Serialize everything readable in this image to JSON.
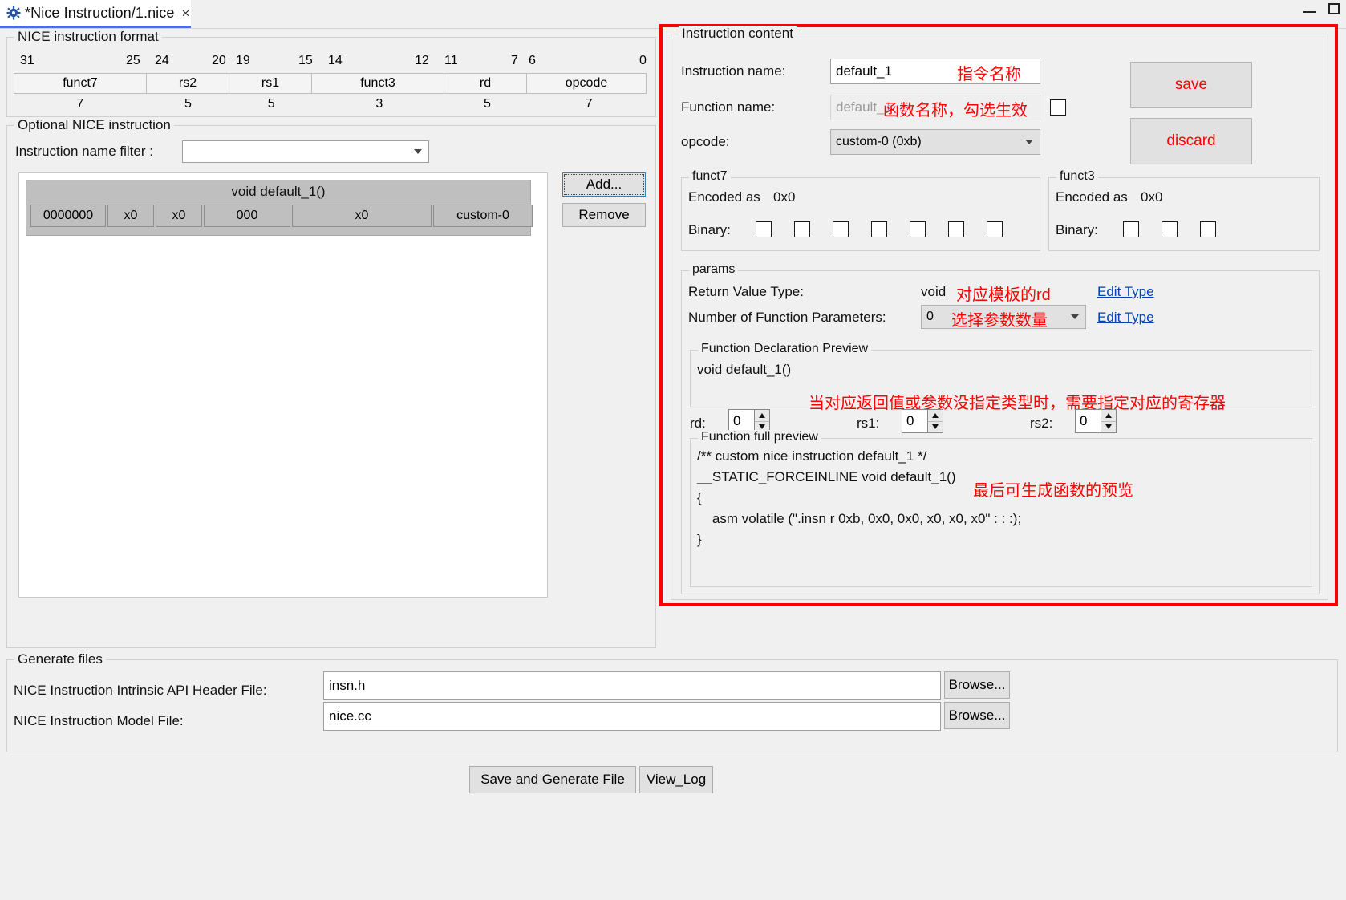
{
  "window": {
    "tab_title": "*Nice Instruction/1.nice",
    "tab_close": "×",
    "minimize": "minimize-icon",
    "maximize": "maximize-icon"
  },
  "format_section": {
    "title": "NICE instruction format",
    "bit_numbers": [
      "31",
      "25",
      "24",
      "20",
      "19",
      "15",
      "14",
      "12",
      "11",
      "7",
      "6",
      "0"
    ],
    "fields": [
      {
        "name": "funct7",
        "width": "7"
      },
      {
        "name": "rs2",
        "width": "5"
      },
      {
        "name": "rs1",
        "width": "5"
      },
      {
        "name": "funct3",
        "width": "3"
      },
      {
        "name": "rd",
        "width": "5"
      },
      {
        "name": "opcode",
        "width": "7"
      }
    ]
  },
  "optional_section": {
    "title": "Optional NICE instruction",
    "filter_label": "Instruction name filter :",
    "filter_value": "",
    "instructions": [
      {
        "signature": "void default_1()",
        "cells": [
          "0000000",
          "x0",
          "x0",
          "000",
          "x0",
          "custom-0"
        ]
      }
    ],
    "add_label": "Add...",
    "remove_label": "Remove"
  },
  "instruction_content": {
    "title": "Instruction content",
    "instruction_name_label": "Instruction name:",
    "instruction_name_value": "default_1",
    "function_name_label": "Function name:",
    "function_name_placeholder": "default_1",
    "function_name_checkbox_checked": false,
    "opcode_label": "opcode:",
    "opcode_value": "custom-0 (0xb)",
    "save_label": "save",
    "discard_label": "discard",
    "annotations": {
      "instruction_name": "指令名称",
      "function_name": "函数名称，勾选生效"
    },
    "funct7": {
      "title": "funct7",
      "encoded_label": "Encoded as",
      "encoded_value": "0x0",
      "binary_label": "Binary:",
      "bits": [
        false,
        false,
        false,
        false,
        false,
        false,
        false
      ]
    },
    "funct3": {
      "title": "funct3",
      "encoded_label": "Encoded as",
      "encoded_value": "0x0",
      "binary_label": "Binary:",
      "bits": [
        false,
        false,
        false
      ]
    },
    "params": {
      "title": "params",
      "return_type_label": "Return Value Type:",
      "return_type_value": "void",
      "return_type_annotation": "对应模板的rd",
      "return_type_edit_link": "Edit Type",
      "param_count_label": "Number of Function Parameters:",
      "param_count_value": "0",
      "param_count_annotation": "选择参数数量",
      "param_count_edit_link": "Edit Type",
      "declaration_preview": {
        "title": "Function Declaration Preview",
        "text": "void default_1()",
        "annotation": "当对应返回值或参数没指定类型时，需要指定对应的寄存器"
      },
      "registers": [
        {
          "label": "rd:",
          "value": "0"
        },
        {
          "label": "rs1:",
          "value": "0"
        },
        {
          "label": "rs2:",
          "value": "0"
        }
      ],
      "full_preview": {
        "title": "Function full preview",
        "annotation": "最后可生成函数的预览",
        "lines": [
          "/** custom nice instruction default_1 */",
          "__STATIC_FORCEINLINE void default_1()",
          "{",
          "    asm volatile (\".insn r 0xb, 0x0, 0x0, x0, x0, x0\" : : :);",
          "}"
        ]
      }
    }
  },
  "generate_files": {
    "title": "Generate files",
    "rows": [
      {
        "label": "NICE Instruction Intrinsic API Header File:",
        "value": "insn.h",
        "browse_label": "Browse..."
      },
      {
        "label": "NICE Instruction Model File:",
        "value": "nice.cc",
        "browse_label": "Browse..."
      }
    ],
    "save_generate_label": "Save and Generate File",
    "view_log_label": "View_Log"
  }
}
